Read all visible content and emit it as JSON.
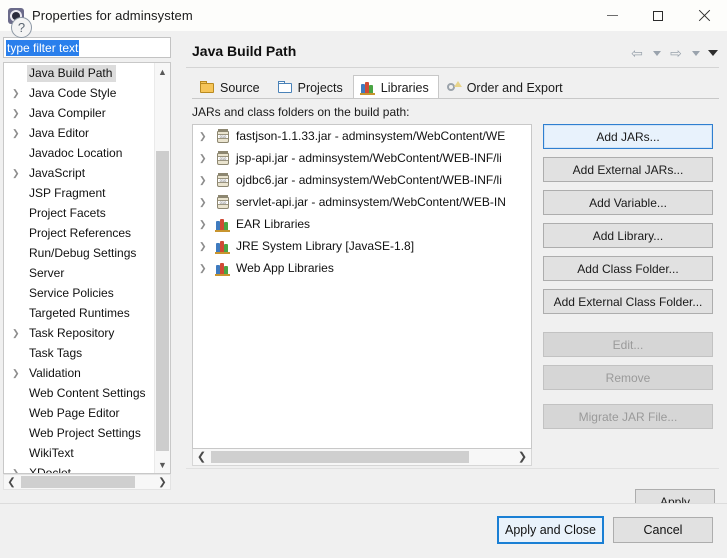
{
  "window": {
    "title": "Properties for adminsystem",
    "icon": "eclipse-properties-icon",
    "minimize_label": "–",
    "maximize_label": "□",
    "close_label": "✕"
  },
  "sidebar": {
    "filter": {
      "value": "type filter text",
      "placeholder": "type filter text",
      "selected": true
    },
    "items": [
      {
        "label": "Java Build Path",
        "expandable": false,
        "selected": true
      },
      {
        "label": "Java Code Style",
        "expandable": true,
        "selected": false
      },
      {
        "label": "Java Compiler",
        "expandable": true,
        "selected": false
      },
      {
        "label": "Java Editor",
        "expandable": true,
        "selected": false
      },
      {
        "label": "Javadoc Location",
        "expandable": false,
        "selected": false
      },
      {
        "label": "JavaScript",
        "expandable": true,
        "selected": false
      },
      {
        "label": "JSP Fragment",
        "expandable": false,
        "selected": false
      },
      {
        "label": "Project Facets",
        "expandable": false,
        "selected": false
      },
      {
        "label": "Project References",
        "expandable": false,
        "selected": false
      },
      {
        "label": "Run/Debug Settings",
        "expandable": false,
        "selected": false
      },
      {
        "label": "Server",
        "expandable": false,
        "selected": false
      },
      {
        "label": "Service Policies",
        "expandable": false,
        "selected": false
      },
      {
        "label": "Targeted Runtimes",
        "expandable": false,
        "selected": false
      },
      {
        "label": "Task Repository",
        "expandable": true,
        "selected": false
      },
      {
        "label": "Task Tags",
        "expandable": false,
        "selected": false
      },
      {
        "label": "Validation",
        "expandable": true,
        "selected": false
      },
      {
        "label": "Web Content Settings",
        "expandable": false,
        "selected": false
      },
      {
        "label": "Web Page Editor",
        "expandable": false,
        "selected": false
      },
      {
        "label": "Web Project Settings",
        "expandable": false,
        "selected": false
      },
      {
        "label": "WikiText",
        "expandable": false,
        "selected": false
      },
      {
        "label": "XDoclet",
        "expandable": true,
        "selected": false
      }
    ],
    "scroll_up_icon": "chevron-up-icon",
    "scroll_down_icon": "chevron-down-icon",
    "scroll_left_icon": "chevron-left-icon",
    "scroll_right_icon": "chevron-right-icon"
  },
  "page": {
    "title": "Java Build Path",
    "nav": {
      "back_icon": "arrow-back-icon",
      "back_menu_icon": "chevron-down-icon",
      "forward_icon": "arrow-forward-icon",
      "forward_menu_icon": "chevron-down-icon",
      "menu_icon": "chevron-down-icon"
    },
    "tabs": [
      {
        "label": "Source",
        "icon": "source-folder-icon",
        "active": false
      },
      {
        "label": "Projects",
        "icon": "projects-folder-icon",
        "active": false
      },
      {
        "label": "Libraries",
        "icon": "libraries-books-icon",
        "active": true
      },
      {
        "label": "Order and Export",
        "icon": "order-export-icon",
        "active": false
      }
    ],
    "section_label": "JARs and class folders on the build path:",
    "entries": [
      {
        "label": "fastjson-1.1.33.jar - adminsystem/WebContent/WE",
        "icon": "jar-file-icon",
        "expandable": true
      },
      {
        "label": "jsp-api.jar - adminsystem/WebContent/WEB-INF/li",
        "icon": "jar-file-icon",
        "expandable": true
      },
      {
        "label": "ojdbc6.jar - adminsystem/WebContent/WEB-INF/li",
        "icon": "jar-file-icon",
        "expandable": true
      },
      {
        "label": "servlet-api.jar - adminsystem/WebContent/WEB-IN",
        "icon": "jar-file-icon",
        "expandable": true
      },
      {
        "label": "EAR Libraries",
        "icon": "library-books-icon",
        "expandable": true
      },
      {
        "label": "JRE System Library [JavaSE-1.8]",
        "icon": "library-books-icon",
        "expandable": true
      },
      {
        "label": "Web App Libraries",
        "icon": "library-books-icon",
        "expandable": true
      }
    ],
    "buttons": [
      {
        "label": "Add JARs...",
        "state": "focused"
      },
      {
        "label": "Add External JARs...",
        "state": "enabled"
      },
      {
        "label": "Add Variable...",
        "state": "enabled"
      },
      {
        "label": "Add Library...",
        "state": "enabled"
      },
      {
        "label": "Add Class Folder...",
        "state": "enabled"
      },
      {
        "label": "Add External Class Folder...",
        "state": "enabled"
      },
      {
        "label": "Edit...",
        "state": "disabled"
      },
      {
        "label": "Remove",
        "state": "disabled"
      },
      {
        "label": "Migrate JAR File...",
        "state": "disabled"
      }
    ],
    "apply_label": "Apply"
  },
  "footer": {
    "help_label": "?",
    "help_icon": "help-question-icon",
    "apply_and_close_label": "Apply and Close",
    "cancel_label": "Cancel"
  },
  "colors": {
    "accent_blue": "#1a7fd4",
    "selection_blue": "#2a7fec",
    "titlebar": "#fdfdfb",
    "dialog_bg": "#f0f0f0",
    "button_bg": "#e1e1e1"
  }
}
